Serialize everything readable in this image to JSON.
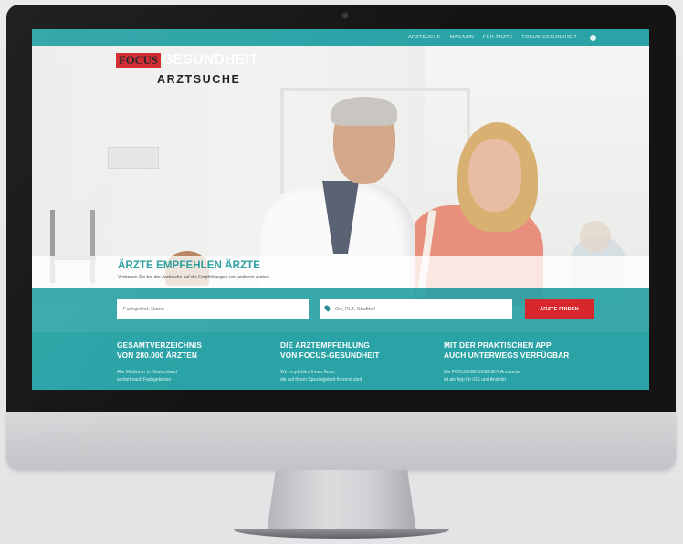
{
  "nav": {
    "items": [
      "ARZTSUCHE",
      "MAGAZIN",
      "FÜR ÄRZTE",
      "FOCUS-GESUNDHEIT"
    ]
  },
  "logo": {
    "brand": "FOCUS",
    "product": "GESUNDHEIT",
    "subtitle": "ARZTSUCHE"
  },
  "banner": {
    "title": "ÄRZTE EMPFEHLEN ÄRZTE",
    "subtitle": "Vertrauen Sie bei der Arztsuche auf die Empfehlungen von anderen Ärzten."
  },
  "search": {
    "field1_placeholder": "Fachgebiet, Name",
    "field2_placeholder": "Ort, PLZ, Stadtteil",
    "button_label": "ÄRZTE FINDEN"
  },
  "info": {
    "columns": [
      {
        "head1": "GESAMTVERZEICHNIS",
        "head2": "VON 280.000 ÄRZTEN",
        "line1": "Alle Mediziner in Deutschland",
        "line2": "sortiert nach Fachgebieten"
      },
      {
        "head1": "DIE ARZTEMPFEHLUNG",
        "head2": "VON FOCUS-GESUNDHEIT",
        "line1": "Wir empfehlen Ihnen Ärzte,",
        "line2": "die auf ihrem Spezialgebiet führend sind"
      },
      {
        "head1": "MIT DER PRAKTISCHEN APP",
        "head2": "AUCH UNTERWEGS VERFÜGBAR",
        "line1": "Die FOCUS-GESUNDHEIT Arztsuche",
        "line2": "ist als App für iOS und Android"
      }
    ]
  },
  "colors": {
    "accent": "#2aa3a6",
    "button": "#d8262d",
    "logo_red": "#d3252c"
  }
}
